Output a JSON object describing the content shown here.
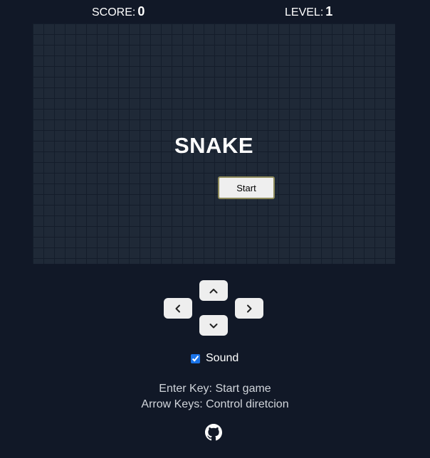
{
  "hud": {
    "score_label": "SCORE:",
    "score_value": "0",
    "level_label": "LEVEL:",
    "level_value": "1"
  },
  "board": {
    "title": "SNAKE",
    "start_label": "Start"
  },
  "controls": {
    "up": "chevron-up-icon",
    "left": "chevron-left-icon",
    "right": "chevron-right-icon",
    "down": "chevron-down-icon"
  },
  "sound": {
    "label": "Sound",
    "checked": true
  },
  "help": {
    "line1": "Enter Key: Start game",
    "line2": "Arrow Keys: Control diretcion"
  },
  "footer": {
    "icon": "github-icon"
  },
  "colors": {
    "background": "#111827",
    "board": "#1f2937",
    "grid_line": "#141d2b",
    "button": "#eeeeee",
    "start_border": "#8d8a5a",
    "help_text": "#d1d5db",
    "checkbox": "#1a73e8"
  }
}
